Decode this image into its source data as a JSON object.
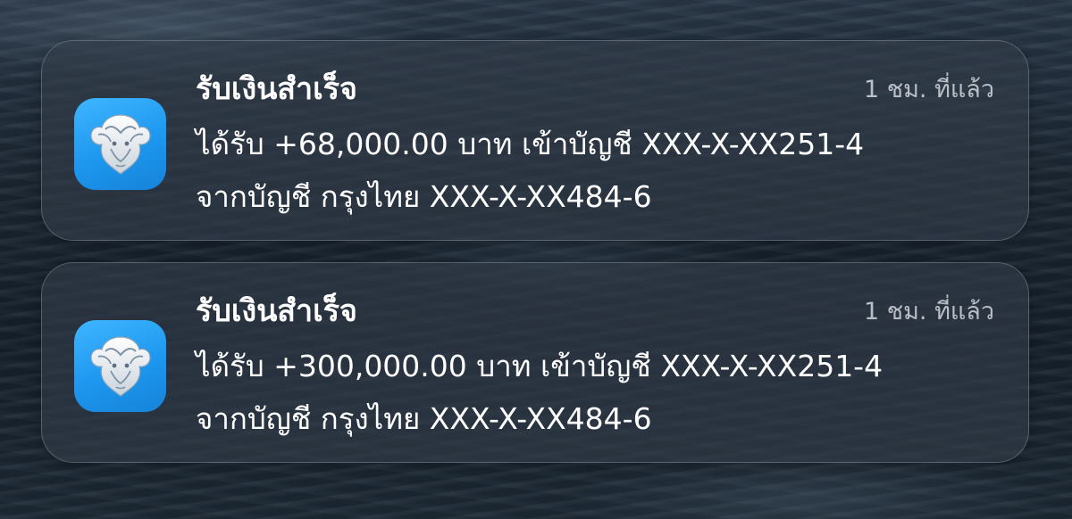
{
  "notifications": [
    {
      "app_icon": "krungthai-bank-logo-icon",
      "title": "รับเงินสำเร็จ",
      "time": "1 ชม. ที่แล้ว",
      "line1": "ได้รับ +68,000.00 บาท เข้าบัญชี XXX-X-XX251-4",
      "line2": "จากบัญชี กรุงไทย XXX-X-XX484-6"
    },
    {
      "app_icon": "krungthai-bank-logo-icon",
      "title": "รับเงินสำเร็จ",
      "time": "1 ชม. ที่แล้ว",
      "line1": "ได้รับ +300,000.00 บาท เข้าบัญชี XXX-X-XX251-4",
      "line2": "จากบัญชี กรุงไทย XXX-X-XX484-6"
    }
  ],
  "colors": {
    "icon_blue": "#1d97ef",
    "text": "#ffffff",
    "time_text": "#e1e6ec"
  }
}
